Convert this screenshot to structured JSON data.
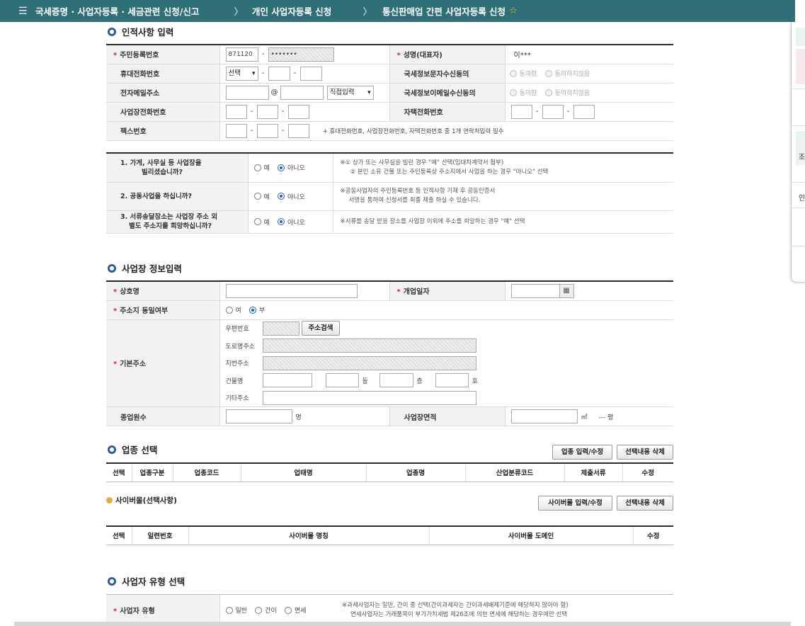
{
  "nav": {
    "menu_icon": "☰",
    "crumb1": "국세증명 · 사업자등록 · 세금관련 신청/신고",
    "crumb2": "개인 사업자등록 신청",
    "crumb3": "통신판매업 간편 사업자등록 신청",
    "chevron": "〉",
    "star_icon": "☆"
  },
  "personal": {
    "title": "인적사항 입력",
    "rrn_label": "주민등록번호",
    "rrn_front": "871120",
    "rrn_back": "•••••••",
    "name_label": "성명(대표자)",
    "name_value": "이***",
    "mobile_label": "휴대전화번호",
    "mobile_select": "선택",
    "tax_info_label": "국세정보문자수신동의",
    "agree": "동의함",
    "disagree": "동의하지않음",
    "email_label": "전자메일주소",
    "email_at": "@",
    "email_domain_select": "직접입력",
    "tax_email_label": "국세정보이메일수신동의",
    "bizphone_label": "사업장전화번호",
    "homephone_label": "자택전화번호",
    "fax_label": "팩스번호",
    "contact_hint": "+ 휴대전화번호, 사업장전화번호, 자택전화번호 중 1개 연락처입력 필수",
    "dash": "-"
  },
  "questions": {
    "yes": "예",
    "no": "아니오",
    "q1_line1": "1. 가게, 사무실 등 사업장을",
    "q1_line2": "빌리셨습니까?",
    "q1_note1": "※① 상가 또는 사무실을 빌린 경우 \"예\" 선택(임대차계약서 첨부)",
    "q1_note2": "② 본인 소유 건물 또는 주민등록상 주소지에서 사업을 하는 경우 \"아니오\" 선택",
    "q2": "2. 공동사업을 하십니까?",
    "q2_note1": "※공동사업자의 주민등록번호 등 인적사항 기재 후 공동인증서",
    "q2_note2": "서명을 통하여 신청서를 최종 제출 하실 수 있습니다.",
    "q3_line1": "3. 서류송달장소는 사업장 주소 외",
    "q3_line2": "별도 주소지를 희망하십니까?",
    "q3_note": "※서류를 송달 받을 장소를 사업장 이외에 주소를 희망하는 경우 \"예\" 선택"
  },
  "business": {
    "title": "사업장 정보입력",
    "trade_name_label": "상호명",
    "open_date_label": "개업일자",
    "calendar_icon": "▦",
    "same_addr_label": "주소지 동일여부",
    "yes": "여",
    "no": "부",
    "base_addr_label": "기본주소",
    "zip_label": "우편번호",
    "addr_search_btn": "주소검색",
    "road_label": "도로명주소",
    "jibun_label": "지번주소",
    "building_label": "건물명",
    "dong_unit": "동",
    "floor_unit": "층",
    "ho_unit": "호",
    "etc_label": "기타주소",
    "employees_label": "종업원수",
    "employees_unit": "명",
    "area_label": "사업장면적",
    "area_unit": "㎡",
    "pyeong_text": "--- 평"
  },
  "industry": {
    "title": "업종 선택",
    "input_btn": "업종 입력/수정",
    "delete_btn": "선택내용 삭제",
    "headers": [
      "선택",
      "업종구분",
      "업종코드",
      "업태명",
      "업종명",
      "산업분류코드",
      "제출서류",
      "수정"
    ]
  },
  "cyber": {
    "title": "사이버몰(선택사항)",
    "input_btn": "사이버몰 입력/수정",
    "delete_btn": "선택내용 삭제",
    "headers": [
      "선택",
      "일련번호",
      "사이버몰 명칭",
      "사이버몰 도메인",
      "수정"
    ]
  },
  "biztype": {
    "title": "사업자 유형 선택",
    "label": "사업자 유형",
    "general": "일반",
    "simple": "간이",
    "exempt": "면세",
    "note1": "※과세사업자는 일반, 간이 중 선택(간이과세자는 간이과세배제기준에 해당하지 않아야 함)",
    "note2": "면세사업자는 거래품목이 부가가치세법 제26조에 의한 면세에 해당하는 경우에만 선택"
  },
  "side": {
    "text1": "조",
    "text2": "인"
  }
}
